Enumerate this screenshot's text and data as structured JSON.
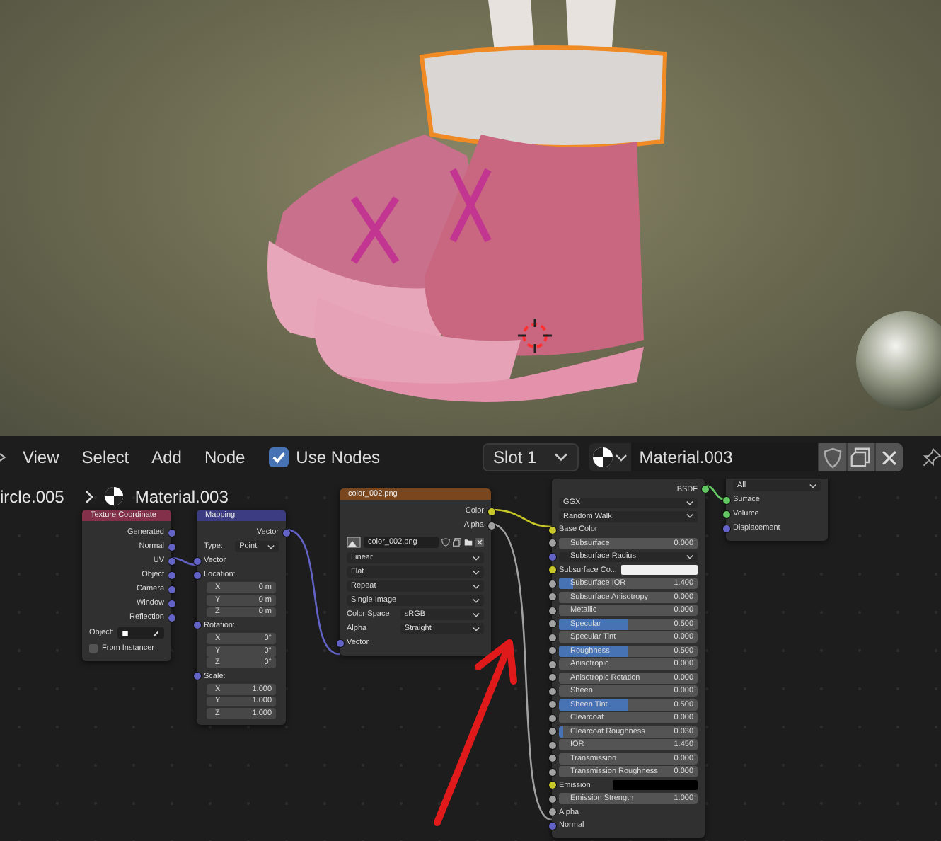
{
  "header": {
    "menus": [
      "View",
      "Select",
      "Add",
      "Node"
    ],
    "use_nodes": {
      "label": "Use Nodes",
      "checked": true
    },
    "slot": "Slot 1",
    "material": "Material.003"
  },
  "breadcrumb": {
    "object": "ircle.005",
    "material": "Material.003"
  },
  "nodes": [
    {
      "title": "Texture Coordinate",
      "color": "#83314a",
      "rows": [
        {
          "kind": "output",
          "label": "Generated",
          "color": "#6363c7"
        },
        {
          "kind": "output",
          "label": "Normal",
          "color": "#6363c7"
        },
        {
          "kind": "output",
          "label": "UV",
          "color": "#6363c7"
        },
        {
          "kind": "output",
          "label": "Object",
          "color": "#6363c7"
        },
        {
          "kind": "output",
          "label": "Camera",
          "color": "#6363c7"
        },
        {
          "kind": "output",
          "label": "Window",
          "color": "#6363c7"
        },
        {
          "kind": "output",
          "label": "Reflection",
          "color": "#6363c7"
        },
        {
          "kind": "object",
          "label": "Object:"
        },
        {
          "kind": "checkbox",
          "label": "From Instancer",
          "checked": false
        }
      ]
    },
    {
      "title": "Mapping",
      "color": "#3c3c83",
      "rows": [
        {
          "kind": "output",
          "label": "Vector",
          "color": "#6363c7"
        },
        {
          "kind": "prop_dropdown",
          "label": "Type:",
          "value": "Point"
        },
        {
          "kind": "input",
          "label": "Vector",
          "color": "#6363c7"
        },
        {
          "kind": "input",
          "label": "Location:",
          "color": "#6363c7"
        },
        {
          "kind": "number",
          "label": "X",
          "value": "0 m"
        },
        {
          "kind": "number",
          "label": "Y",
          "value": "0 m"
        },
        {
          "kind": "number",
          "label": "Z",
          "value": "0 m"
        },
        {
          "kind": "input",
          "label": "Rotation:",
          "color": "#6363c7"
        },
        {
          "kind": "number",
          "label": "X",
          "value": "0°"
        },
        {
          "kind": "number",
          "label": "Y",
          "value": "0°"
        },
        {
          "kind": "number",
          "label": "Z",
          "value": "0°"
        },
        {
          "kind": "input",
          "label": "Scale:",
          "color": "#6363c7"
        },
        {
          "kind": "number",
          "label": "X",
          "value": "1.000"
        },
        {
          "kind": "number",
          "label": "Y",
          "value": "1.000"
        },
        {
          "kind": "number",
          "label": "Z",
          "value": "1.000"
        }
      ]
    },
    {
      "title": "color_002.png",
      "color": "#79461d",
      "rows": [
        {
          "kind": "output",
          "label": "Color",
          "color": "#c7c729"
        },
        {
          "kind": "output",
          "label": "Alpha",
          "color": "#a1a1a1"
        },
        {
          "kind": "image",
          "value": "color_002.png"
        },
        {
          "kind": "dropdown",
          "value": "Linear"
        },
        {
          "kind": "dropdown",
          "value": "Flat"
        },
        {
          "kind": "dropdown",
          "value": "Repeat"
        },
        {
          "kind": "dropdown",
          "value": "Single Image"
        },
        {
          "kind": "prop_dropdown",
          "label": "Color Space",
          "value": "sRGB"
        },
        {
          "kind": "prop_dropdown",
          "label": "Alpha",
          "value": "Straight"
        },
        {
          "kind": "input",
          "label": "Vector",
          "color": "#6363c7"
        }
      ]
    },
    {
      "rows": [
        {
          "kind": "output",
          "label": "BSDF",
          "color": "#63c763"
        },
        {
          "kind": "dropdown",
          "value": "GGX"
        },
        {
          "kind": "dropdown",
          "value": "Random Walk"
        },
        {
          "kind": "input",
          "label": "Base Color",
          "color": "#c7c729"
        },
        {
          "kind": "slider",
          "label": "Subsurface",
          "value": "0.000",
          "level": 0,
          "color": "#a1a1a1"
        },
        {
          "kind": "socket_dropdown",
          "label": "Subsurface Radius",
          "color": "#6363c7"
        },
        {
          "kind": "swatch",
          "label": "Subsurface Co...",
          "color": "#f0f0f0",
          "socket": {
            "color": "#c7c729"
          }
        },
        {
          "kind": "slider",
          "label": "Subsurface IOR",
          "value": "1.400",
          "level": 0.1,
          "color": "#a1a1a1"
        },
        {
          "kind": "slider",
          "label": "Subsurface Anisotropy",
          "value": "0.000",
          "level": 0,
          "color": "#a1a1a1"
        },
        {
          "kind": "slider",
          "label": "Metallic",
          "value": "0.000",
          "level": 0,
          "color": "#a1a1a1"
        },
        {
          "kind": "slider",
          "label": "Specular",
          "value": "0.500",
          "level": 0.5,
          "color": "#a1a1a1"
        },
        {
          "kind": "slider",
          "label": "Specular Tint",
          "value": "0.000",
          "level": 0,
          "color": "#a1a1a1"
        },
        {
          "kind": "slider",
          "label": "Roughness",
          "value": "0.500",
          "level": 0.5,
          "color": "#a1a1a1"
        },
        {
          "kind": "slider",
          "label": "Anisotropic",
          "value": "0.000",
          "level": 0,
          "color": "#a1a1a1"
        },
        {
          "kind": "slider",
          "label": "Anisotropic Rotation",
          "value": "0.000",
          "level": 0,
          "color": "#a1a1a1"
        },
        {
          "kind": "slider",
          "label": "Sheen",
          "value": "0.000",
          "level": 0,
          "color": "#a1a1a1"
        },
        {
          "kind": "slider",
          "label": "Sheen Tint",
          "value": "0.500",
          "level": 0.5,
          "color": "#a1a1a1"
        },
        {
          "kind": "slider",
          "label": "Clearcoat",
          "value": "0.000",
          "level": 0,
          "color": "#a1a1a1"
        },
        {
          "kind": "slider",
          "label": "Clearcoat Roughness",
          "value": "0.030",
          "level": 0.03,
          "color": "#a1a1a1"
        },
        {
          "kind": "slider",
          "label": "IOR",
          "value": "1.450",
          "level": 0,
          "color": "#a1a1a1"
        },
        {
          "kind": "slider",
          "label": "Transmission",
          "value": "0.000",
          "level": 0,
          "color": "#a1a1a1"
        },
        {
          "kind": "slider",
          "label": "Transmission Roughness",
          "value": "0.000",
          "level": 0,
          "color": "#a1a1a1"
        },
        {
          "kind": "swatch",
          "label": "Emission",
          "color": "#000000",
          "socket": {
            "color": "#c7c729"
          }
        },
        {
          "kind": "slider",
          "label": "Emission Strength",
          "value": "1.000",
          "level": 0,
          "color": "#a1a1a1"
        },
        {
          "kind": "input",
          "label": "Alpha",
          "color": "#a1a1a1"
        },
        {
          "kind": "input",
          "label": "Normal",
          "color": "#6363c7"
        }
      ]
    },
    {
      "rows": [
        {
          "kind": "dropdown",
          "value": "All"
        },
        {
          "kind": "input",
          "label": "Surface",
          "color": "#63c763"
        },
        {
          "kind": "input",
          "label": "Volume",
          "color": "#63c763"
        },
        {
          "kind": "input",
          "label": "Displacement",
          "color": "#6363c7"
        }
      ]
    }
  ]
}
